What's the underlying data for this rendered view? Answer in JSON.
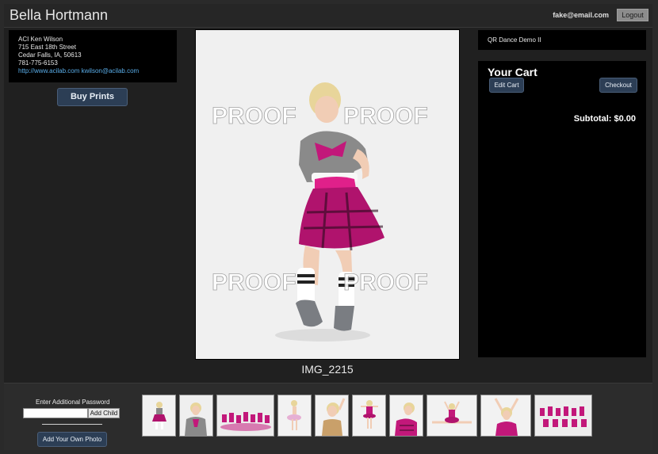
{
  "header": {
    "title": "Bella Hortmann",
    "email": "fake@email.com",
    "logout_label": "Logout"
  },
  "studio": {
    "name": "ACI Ken Wilson",
    "street": "715 East 18th Street",
    "city": "Cedar Falls, IA, 50613",
    "phone": "781-775-6153",
    "website": "http://www.acilab.com",
    "contact_email": "kwilson@acilab.com"
  },
  "buy_label": "Buy Prints",
  "photo": {
    "watermark": "PROOF",
    "caption": "IMG_2215"
  },
  "album": {
    "name": "QR Dance Demo II"
  },
  "cart": {
    "title": "Your Cart",
    "edit_label": "Edit Cart",
    "checkout_label": "Checkout",
    "subtotal_text": "Subtotal: $0.00"
  },
  "footer": {
    "password_label": "Enter Additional Password",
    "add_child_label": "Add Child",
    "add_photo_label": "Add Your Own Photo"
  },
  "colors": {
    "accent_button": "#2c3e55",
    "link": "#5aaeea",
    "dress_pink": "#c2187a",
    "jacket_gray": "#8a8a8a"
  }
}
